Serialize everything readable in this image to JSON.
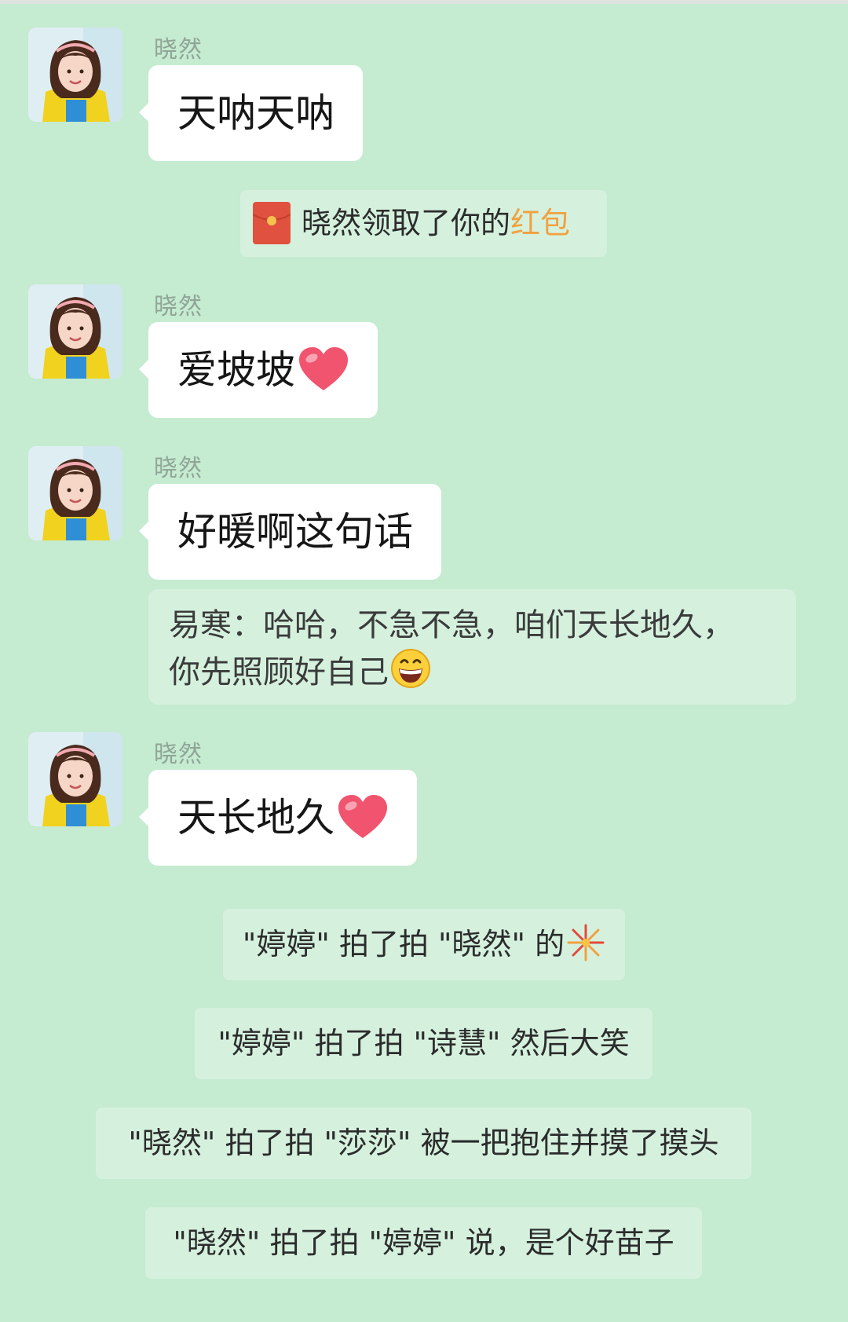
{
  "messages": [
    {
      "sender": "晓然",
      "text": "天呐天呐"
    },
    {
      "sender": "晓然",
      "text": "爱坡坡",
      "emoji": "heart-emoji"
    },
    {
      "sender": "晓然",
      "text": "好暖啊这句话"
    },
    {
      "sender": "晓然",
      "text": "天长地久",
      "emoji": "heart-emoji"
    }
  ],
  "system": {
    "red_packet_prefix": "晓然领取了你的",
    "red_packet_link": "红包"
  },
  "quote": {
    "line1": "易寒：哈哈，不急不急，咱们天长地久，",
    "line2": "你先照顾好自己",
    "emoji": "grinning-emoji"
  },
  "pats": [
    {
      "text": "\"婷婷\" 拍了拍 \"晓然\" 的",
      "emoji": "firework-emoji"
    },
    {
      "text": "\"婷婷\" 拍了拍 \"诗慧\" 然后大笑"
    },
    {
      "text": "\"晓然\" 拍了拍 \"莎莎\" 被一把抱住并摸了摸头"
    },
    {
      "text": "\"晓然\" 拍了拍 \"婷婷\" 说，是个好苗子"
    }
  ],
  "colors": {
    "background": "#c5ebd1",
    "bubble": "#ffffff",
    "system_bubble": "#d5f1de",
    "link": "#f0a140",
    "sender_name": "#8fa597"
  }
}
